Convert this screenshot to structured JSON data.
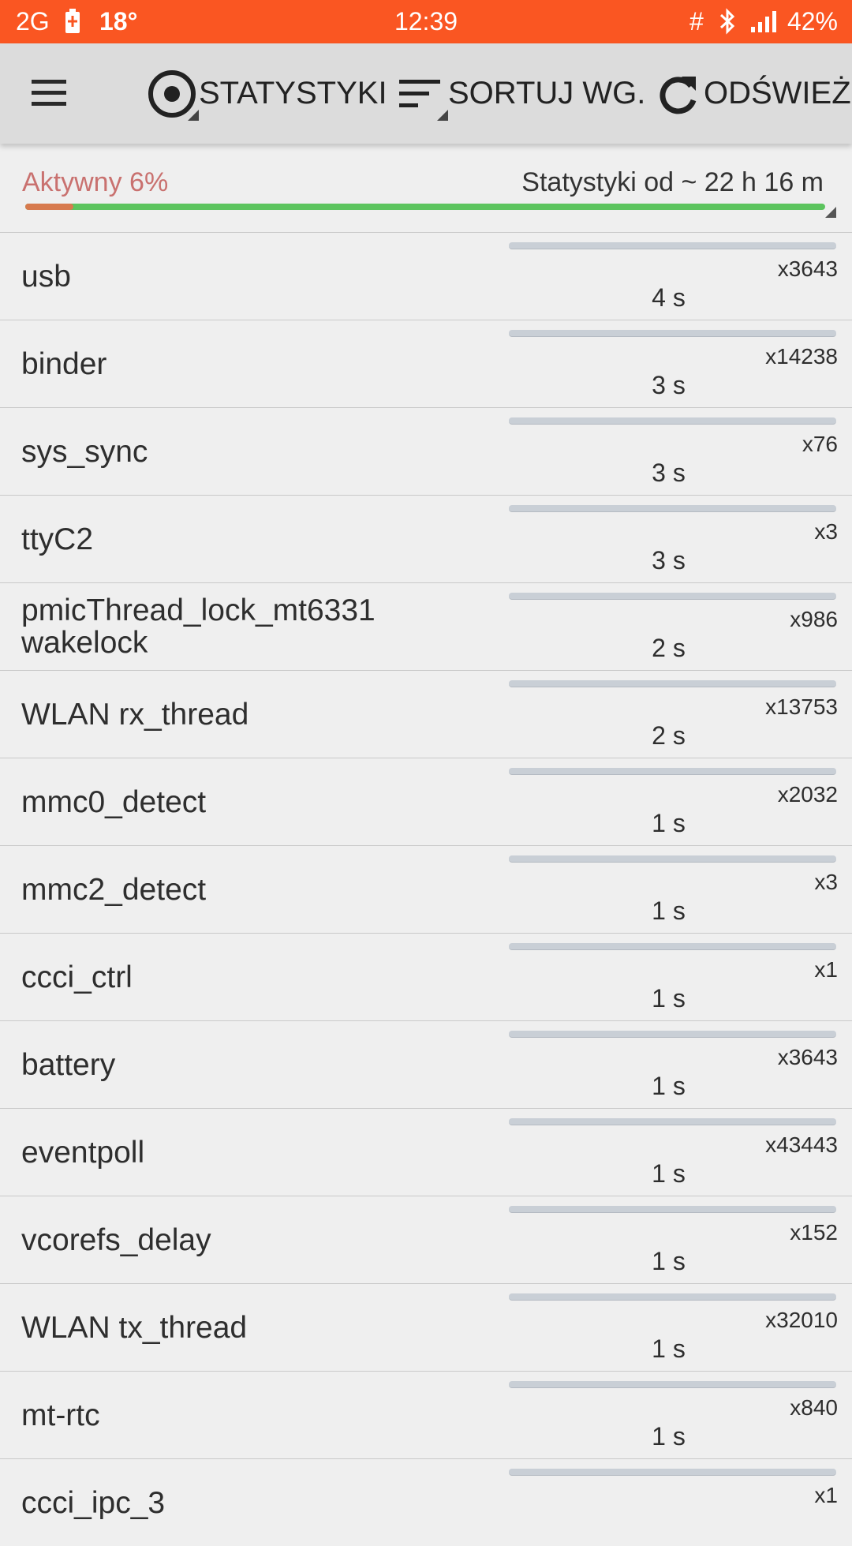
{
  "status_bar": {
    "network": "2G",
    "temperature": "18°",
    "clock": "12:39",
    "hash": "#",
    "battery_percent": "42%",
    "accent_color": "#fa5622"
  },
  "toolbar": {
    "menu_icon": "hamburger-menu-icon",
    "stats_label": "STATYSTYKI",
    "sort_label": "SORTUJ WG.",
    "refresh_label": "ODŚWIEŻ"
  },
  "summary": {
    "active_label": "Aktywny 6%",
    "active_fraction": 0.06,
    "since_label": "Statystyki od ~ 22 h 16 m"
  },
  "rows": [
    {
      "name": "usb",
      "count": "x3643",
      "time": "4 s",
      "fraction": 0.0
    },
    {
      "name": "binder",
      "count": "x14238",
      "time": "3 s",
      "fraction": 0.0
    },
    {
      "name": "sys_sync",
      "count": "x76",
      "time": "3 s",
      "fraction": 0.0
    },
    {
      "name": "ttyC2",
      "count": "x3",
      "time": "3 s",
      "fraction": 0.0
    },
    {
      "name": "pmicThread_lock_mt6331 wakelock",
      "count": "x986",
      "time": "2 s",
      "fraction": 0.0
    },
    {
      "name": "WLAN rx_thread",
      "count": "x13753",
      "time": "2 s",
      "fraction": 0.0
    },
    {
      "name": "mmc0_detect",
      "count": "x2032",
      "time": "1 s",
      "fraction": 0.0
    },
    {
      "name": "mmc2_detect",
      "count": "x3",
      "time": "1 s",
      "fraction": 0.0
    },
    {
      "name": "ccci_ctrl",
      "count": "x1",
      "time": "1 s",
      "fraction": 0.0
    },
    {
      "name": "battery",
      "count": "x3643",
      "time": "1 s",
      "fraction": 0.0
    },
    {
      "name": "eventpoll",
      "count": "x43443",
      "time": "1 s",
      "fraction": 0.0
    },
    {
      "name": "vcorefs_delay",
      "count": "x152",
      "time": "1 s",
      "fraction": 0.0
    },
    {
      "name": "WLAN tx_thread",
      "count": "x32010",
      "time": "1 s",
      "fraction": 0.0
    },
    {
      "name": "mt-rtc",
      "count": "x840",
      "time": "1 s",
      "fraction": 0.0
    },
    {
      "name": "ccci_ipc_3",
      "count": "x1",
      "time": "",
      "fraction": 0.0
    }
  ]
}
